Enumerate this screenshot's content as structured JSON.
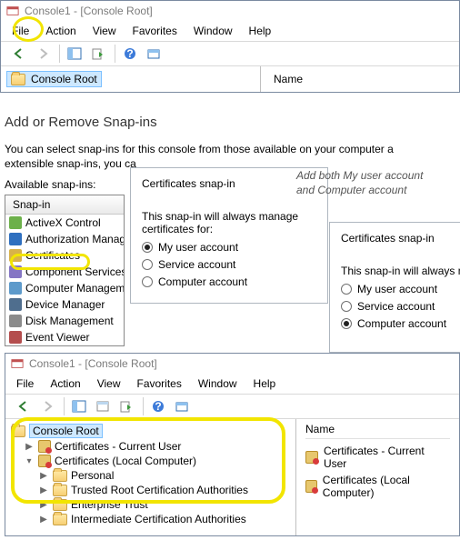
{
  "window_title": "Console1 - [Console Root]",
  "menu": {
    "file": "File",
    "action": "Action",
    "view": "View",
    "favorites": "Favorites",
    "window": "Window",
    "help": "Help"
  },
  "root_folder": "Console Root",
  "column_name": "Name",
  "dialog": {
    "title": "Add or Remove Snap-ins",
    "body_line1": "You can select snap-ins for this console from those available on your computer a",
    "body_line2": "extensible snap-ins, you ca",
    "available_label": "Available snap-ins:",
    "header": "Snap-in",
    "items": [
      {
        "label": "ActiveX Control",
        "cls": "ax"
      },
      {
        "label": "Authorization Manage",
        "cls": "auth"
      },
      {
        "label": "Certificates",
        "cls": "cert"
      },
      {
        "label": "Component Services",
        "cls": "comp"
      },
      {
        "label": "Computer Managem",
        "cls": "mgmt"
      },
      {
        "label": "Device Manager",
        "cls": "dev"
      },
      {
        "label": "Disk Management",
        "cls": "disk"
      },
      {
        "label": "Event Viewer",
        "cls": "evt"
      }
    ]
  },
  "cert_panel": {
    "title": "Certificates snap-in",
    "prompt": "This snap-in will always manage certificates for:",
    "opt_user": "My user account",
    "opt_service": "Service account",
    "opt_computer": "Computer account"
  },
  "annot": {
    "line1": "Add both My user account",
    "line2": "and Computer account"
  },
  "cert_panel2": {
    "title": "Certificates snap-in",
    "prompt": "This snap-in will always manag"
  },
  "tree": {
    "root": "Console Root",
    "cert_user": "Certificates - Current User",
    "cert_comp": "Certificates (Local Computer)",
    "personal": "Personal",
    "trca": "Trusted Root Certification Authorities",
    "ent": "Enterprise Trust",
    "intca": "Intermediate Certification Authorities"
  },
  "list": {
    "cert_user": "Certificates - Current User",
    "cert_comp": "Certificates (Local Computer)"
  }
}
